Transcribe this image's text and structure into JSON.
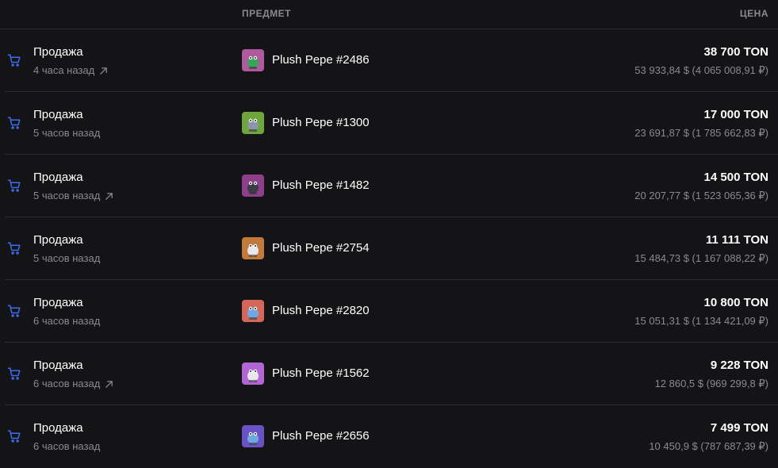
{
  "header": {
    "item_label": "ПРЕДМЕТ",
    "price_label": "ЦЕНА"
  },
  "colors": {
    "accent": "#3d6df2",
    "background": "#141416",
    "muted": "#8a8a90"
  },
  "rows": [
    {
      "action": "Продажа",
      "time": "4 часа назад",
      "has_link": true,
      "item": "Plush Pepe #2486",
      "thumb_color": "#b05a9e",
      "thumb_icon": "pepe-plush-green",
      "price": "38 700 TON",
      "fiat": "53 933,84 $ (4 065 008,91 ₽)"
    },
    {
      "action": "Продажа",
      "time": "5 часов назад",
      "has_link": false,
      "item": "Plush Pepe #1300",
      "thumb_color": "#6fa63c",
      "thumb_icon": "pepe-plush-gray",
      "price": "17 000 TON",
      "fiat": "23 691,87 $ (1 785 662,83 ₽)"
    },
    {
      "action": "Продажа",
      "time": "5 часов назад",
      "has_link": true,
      "item": "Plush Pepe #1482",
      "thumb_color": "#8e3f8a",
      "thumb_icon": "pepe-plush-dark",
      "price": "14 500 TON",
      "fiat": "20 207,77 $ (1 523 065,36 ₽)"
    },
    {
      "action": "Продажа",
      "time": "5 часов назад",
      "has_link": false,
      "item": "Plush Pepe #2754",
      "thumb_color": "#c27a3c",
      "thumb_icon": "pepe-plush-white",
      "price": "11 111 TON",
      "fiat": "15 484,73 $ (1 167 088,22 ₽)"
    },
    {
      "action": "Продажа",
      "time": "6 часов назад",
      "has_link": false,
      "item": "Plush Pepe #2820",
      "thumb_color": "#d4665a",
      "thumb_icon": "pepe-plush-blue",
      "price": "10 800 TON",
      "fiat": "15 051,31 $ (1 134 421,09 ₽)"
    },
    {
      "action": "Продажа",
      "time": "6 часов назад",
      "has_link": true,
      "item": "Plush Pepe #1562",
      "thumb_color": "#b266d6",
      "thumb_icon": "pepe-plush-white",
      "price": "9 228 TON",
      "fiat": "12 860,5 $ (969 299,8 ₽)"
    },
    {
      "action": "Продажа",
      "time": "6 часов назад",
      "has_link": false,
      "item": "Plush Pepe #2656",
      "thumb_color": "#6a52c4",
      "thumb_icon": "pepe-plush-blue",
      "price": "7 499 TON",
      "fiat": "10 450,9 $ (787 687,39 ₽)"
    }
  ]
}
